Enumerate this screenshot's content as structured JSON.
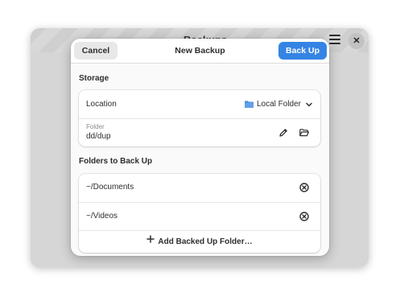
{
  "app": {
    "title": "Backups",
    "icons": {
      "menu": "hamburger-menu-icon",
      "close": "close-icon"
    }
  },
  "dialog": {
    "title": "New Backup",
    "cancel_label": "Cancel",
    "backup_label": "Back Up",
    "accent_color": "#3584e4"
  },
  "storage": {
    "section_label": "Storage",
    "location_label": "Location",
    "location_value": "Local Folder",
    "folder_label": "Folder",
    "folder_value": "dd/dup"
  },
  "folders": {
    "section_label": "Folders to Back Up",
    "items": [
      {
        "path": "~/Documents"
      },
      {
        "path": "~/Videos"
      }
    ],
    "add_label": "Add Backed Up Folder…"
  }
}
